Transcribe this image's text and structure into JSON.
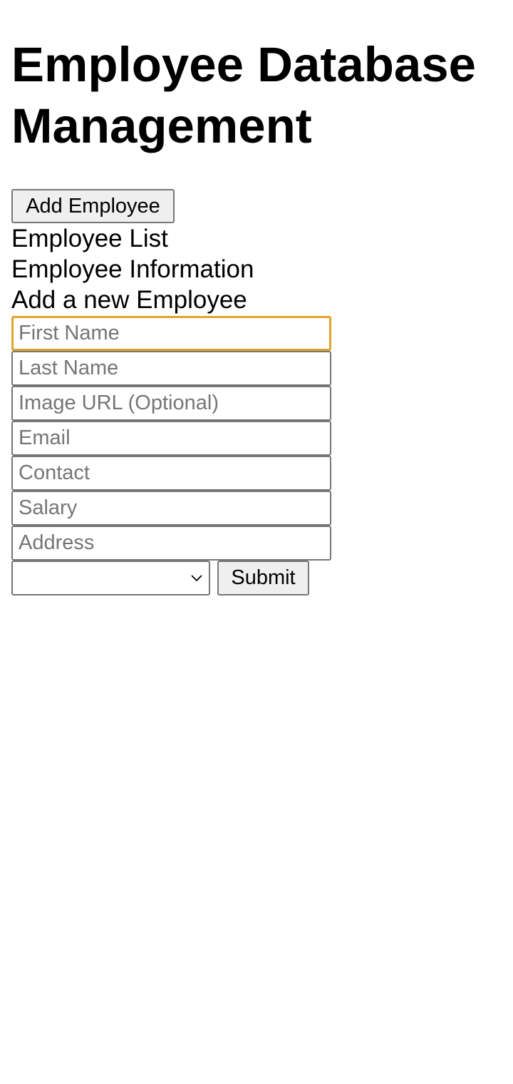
{
  "header": {
    "title": "Employee Database Management"
  },
  "actions": {
    "add_employee_label": "Add Employee"
  },
  "sections": {
    "employee_list": "Employee List",
    "employee_information": "Employee Information",
    "add_new_employee": "Add a new Employee"
  },
  "form": {
    "first_name_placeholder": "First Name",
    "last_name_placeholder": "Last Name",
    "image_url_placeholder": "Image URL (Optional)",
    "email_placeholder": "Email",
    "contact_placeholder": "Contact",
    "salary_placeholder": "Salary",
    "address_placeholder": "Address",
    "select_value": "",
    "submit_label": "Submit"
  },
  "colors": {
    "focus_ring": "#e0a526",
    "input_border": "#767676",
    "button_background": "#efefef",
    "placeholder_text": "#757575"
  },
  "icons": {
    "select_arrow": "chevron-down-icon"
  }
}
